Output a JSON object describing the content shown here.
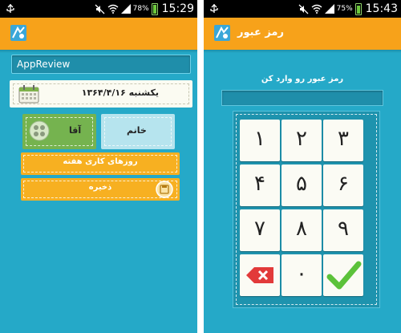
{
  "left": {
    "status": {
      "battery_percent": "78%",
      "time": "15:29"
    },
    "name_field": {
      "value": "AppReview"
    },
    "date_field": {
      "value": "یکشنبه ۱۳۶۴/۴/۱۶"
    },
    "gender": {
      "female_label": "خانم",
      "male_label": "آقا"
    },
    "week_days_button": "روزهای کاری هفته",
    "save_button": "ذخیره"
  },
  "right": {
    "status": {
      "battery_percent": "75%",
      "time": "15:43"
    },
    "title": "رمز عبور",
    "prompt": "رمز عبور رو وارد کن",
    "keys": {
      "k1": "۱",
      "k2": "۲",
      "k3": "۳",
      "k4": "۴",
      "k5": "۵",
      "k6": "۶",
      "k7": "۷",
      "k8": "۸",
      "k9": "۹",
      "k0": "۰"
    }
  },
  "colors": {
    "background": "#25a9c8",
    "appbar": "#f7a21a",
    "button": "#f7b021",
    "male": "#75b34f",
    "female": "#b6e4ee",
    "delete": "#e23a3a",
    "confirm": "#5cc23a"
  }
}
